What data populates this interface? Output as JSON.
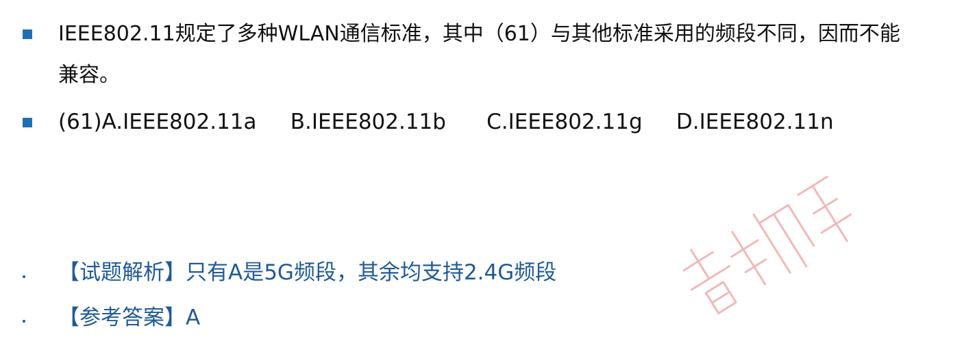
{
  "question": {
    "text": "IEEE802.11规定了多种WLAN通信标准，其中（61）与其他标准采用的频段不同，因而不能兼容。"
  },
  "options": {
    "line": "(61)A.IEEE802.11a     B.IEEE802.11b      C.IEEE802.11g     D.IEEE802.11n"
  },
  "analysis": {
    "text": "【试题解析】只有A是5G频段，其余均支持2.4G频段"
  },
  "answer": {
    "text": "【参考答案】A"
  },
  "colors": {
    "bullet_square": "#1f6fb5",
    "answer_text": "#1f5a99",
    "watermark": "#f2b8b8"
  }
}
